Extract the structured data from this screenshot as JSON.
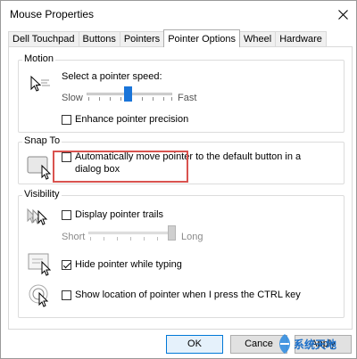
{
  "window": {
    "title": "Mouse Properties"
  },
  "tabs": [
    {
      "label": "Dell Touchpad",
      "active": false
    },
    {
      "label": "Buttons",
      "active": false
    },
    {
      "label": "Pointers",
      "active": false
    },
    {
      "label": "Pointer Options",
      "active": true
    },
    {
      "label": "Wheel",
      "active": false
    },
    {
      "label": "Hardware",
      "active": false
    }
  ],
  "motion": {
    "title": "Motion",
    "speed_label": "Select a pointer speed:",
    "slow_label": "Slow",
    "fast_label": "Fast",
    "speed_value": 0.48,
    "enhance_label": "Enhance pointer precision",
    "enhance_checked": false
  },
  "snap_to": {
    "title": "Snap To",
    "auto_move_label_line1": "Automatically move pointer to the default button in a",
    "auto_move_label_line2": "dialog box",
    "auto_move_checked": false
  },
  "visibility": {
    "title": "Visibility",
    "trails_label": "Display pointer trails",
    "trails_checked": false,
    "short_label": "Short",
    "long_label": "Long",
    "trail_value": 1.0,
    "hide_label": "Hide pointer while typing",
    "hide_checked": true,
    "show_location_label": "Show location of pointer when I press the CTRL key",
    "show_location_checked": false
  },
  "buttons": {
    "ok": "OK",
    "cancel": "Cance",
    "apply": "Apply"
  },
  "watermark": {
    "text": "系统天地"
  },
  "colors": {
    "accent": "#1a75d9",
    "highlight_box": "#d9534f"
  }
}
